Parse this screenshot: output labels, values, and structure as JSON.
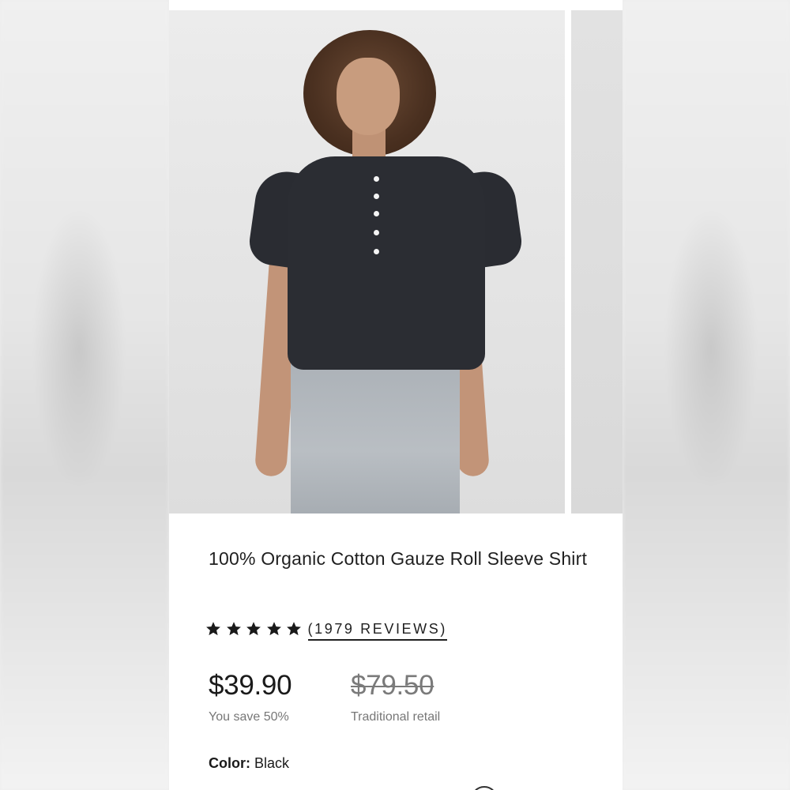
{
  "product": {
    "title": "100% Organic Cotton Gauze Roll Sleeve Shirt",
    "rating": {
      "stars": 5,
      "star_icon": "star-icon",
      "reviews_label": "(1979 REVIEWS)"
    },
    "price": {
      "current": "$39.90",
      "savings": "You save 50%",
      "original": "$79.50",
      "original_label": "Traditional retail"
    },
    "color": {
      "label": "Color:",
      "value": "Black"
    }
  },
  "colors": {
    "text": "#1f1f1f",
    "muted": "#777777",
    "shirt": "#2b2d33",
    "background": "#ffffff"
  }
}
